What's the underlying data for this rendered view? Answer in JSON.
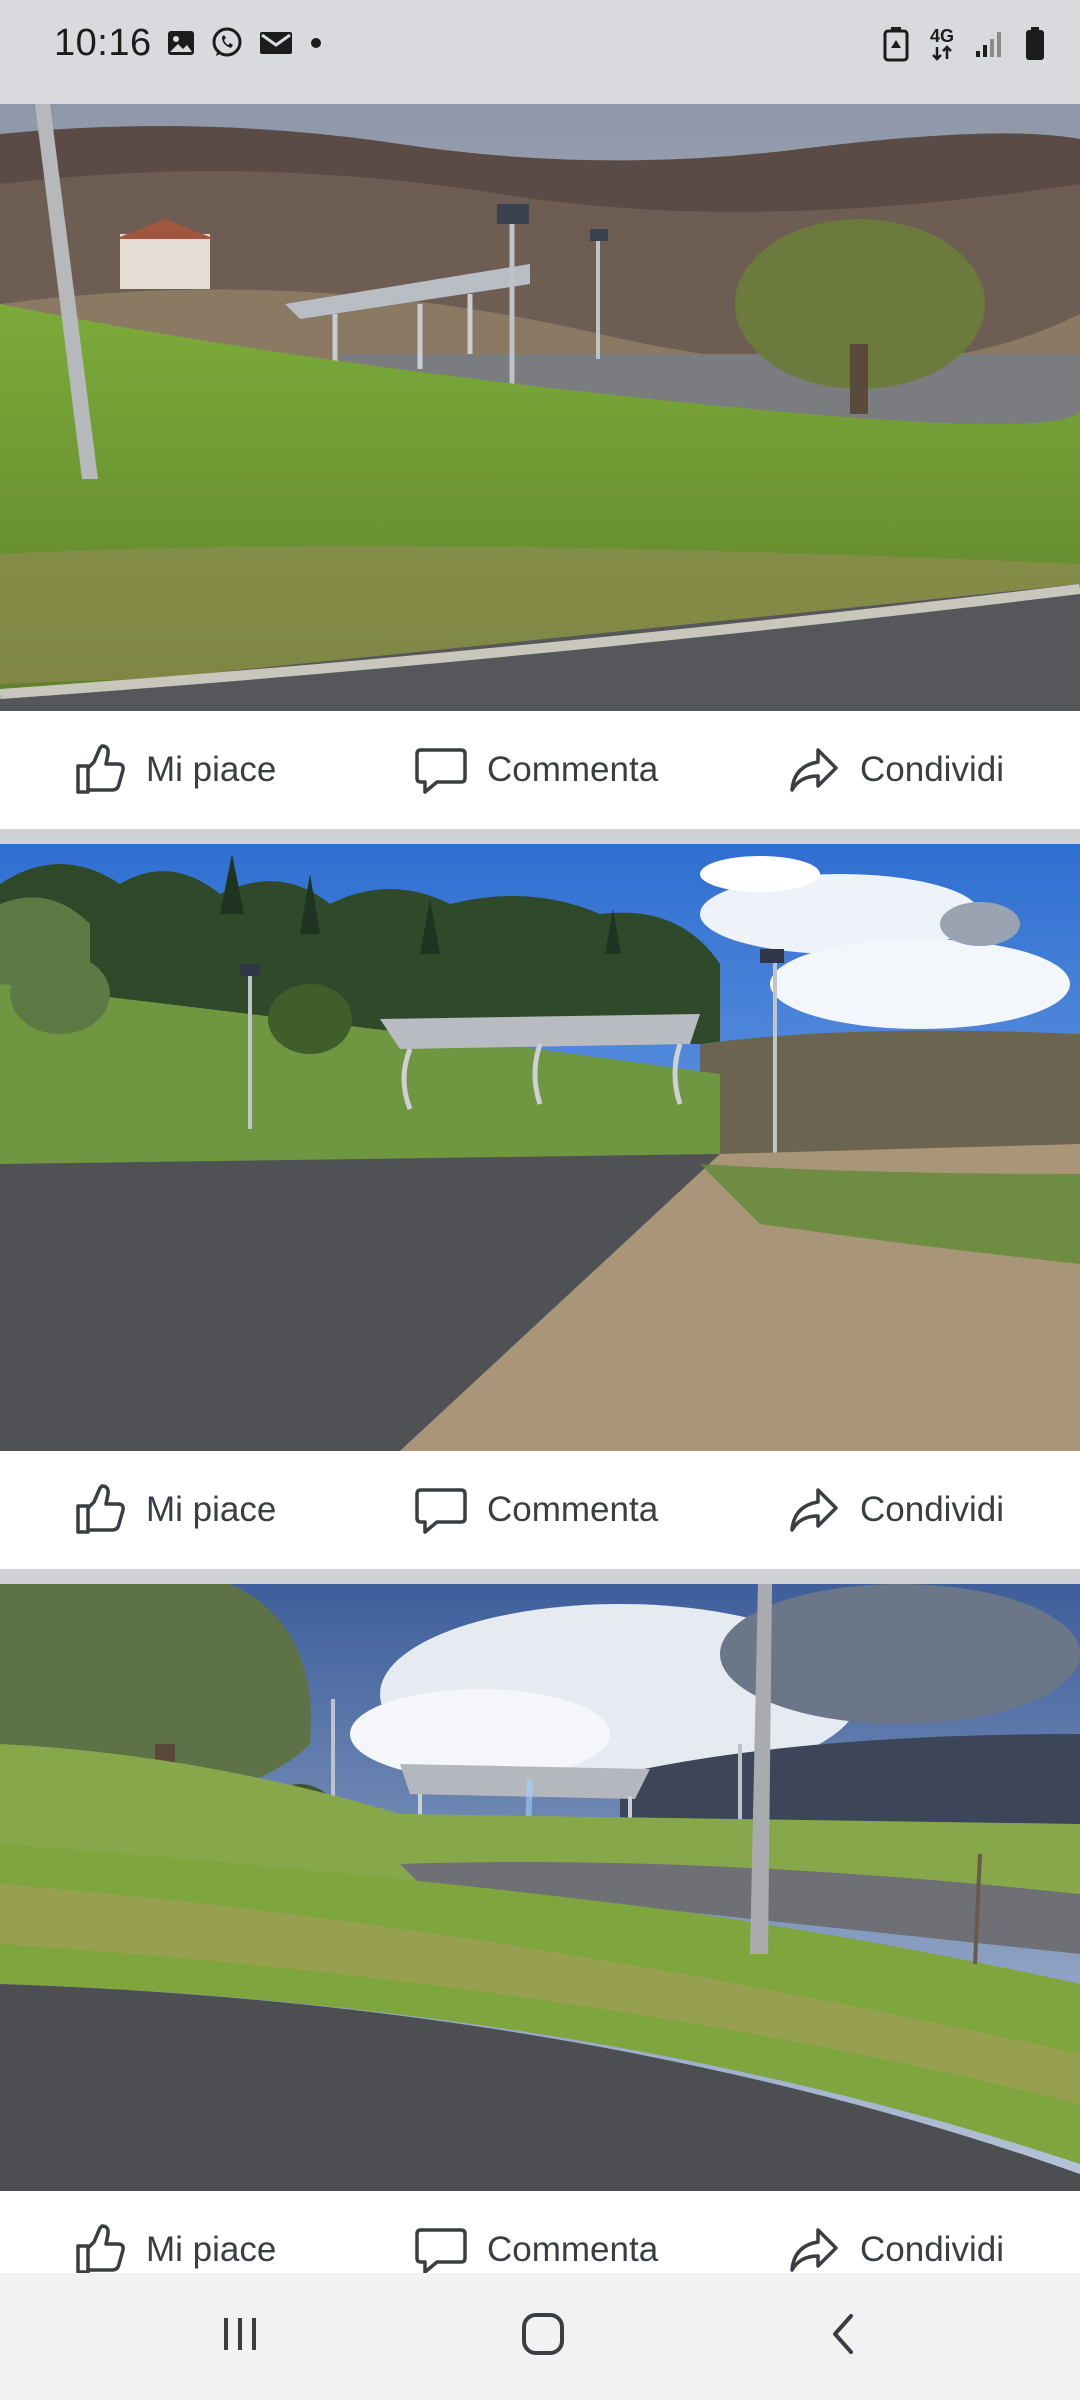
{
  "status_bar": {
    "time": "10:16",
    "left_icons": [
      "gallery-icon",
      "whatsapp-icon",
      "mail-icon",
      "dot-icon"
    ],
    "right_icons": [
      "battery-saver-icon",
      "network-4g-icon",
      "signal-icon",
      "battery-icon"
    ],
    "network_label": "4G"
  },
  "posts": [
    {
      "image": "Rural landscape: grassy slope with street light pole, solar canopy structure and olive tree, hills behind",
      "actions": {
        "like": "Mi piace",
        "comment": "Commenta",
        "share": "Condividi"
      }
    },
    {
      "image": "Asphalt parking area with solar panel carport, cypress and pine trees under blue sky",
      "actions": {
        "like": "Mi piace",
        "comment": "Commenta",
        "share": "Condividi"
      }
    },
    {
      "image": "Road curve with grass verge, light pole and solar carport in the distance, cloudy sky and hills",
      "actions": {
        "like": "Mi piace",
        "comment": "Commenta",
        "share": "Condividi"
      }
    }
  ],
  "nav_bar": {
    "buttons": [
      "recent-apps",
      "home",
      "back"
    ]
  }
}
